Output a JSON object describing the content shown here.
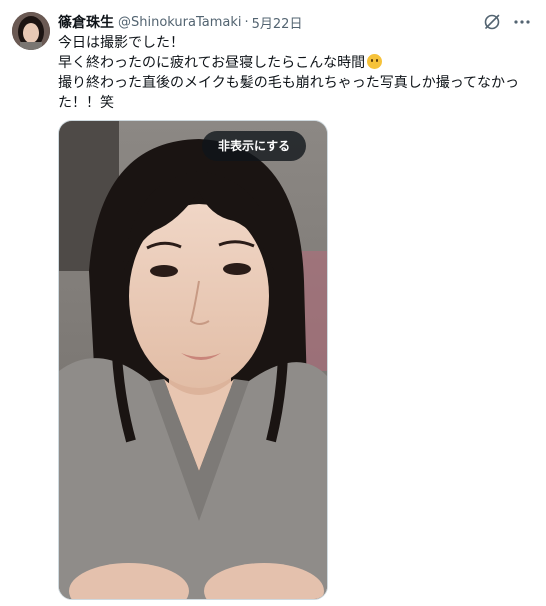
{
  "post": {
    "author_name": "篠倉珠生",
    "handle": "@ShinokuraTamaki",
    "separator": "·",
    "date": "5月22日",
    "text_lines": [
      "今日は撮影でした！",
      "早く終わったのに疲れてお昼寝したらこんな時間",
      "撮り終わった直後のメイクも髪の毛も崩れちゃった写真しか撮ってなかった！！笑"
    ],
    "emoji_name": "smiling-face-with-tear",
    "media": {
      "hide_label": "非表示にする"
    },
    "icons": {
      "grok": "grok-icon",
      "more": "more-icon"
    }
  }
}
